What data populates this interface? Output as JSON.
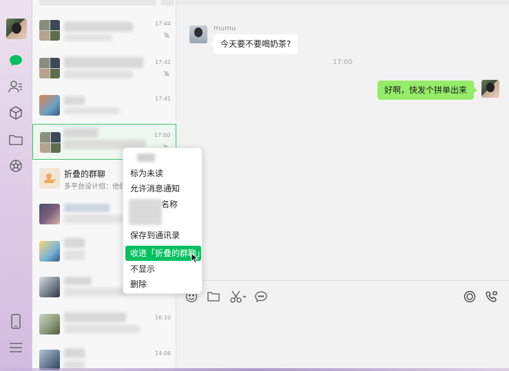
{
  "colors": {
    "accent_green": "#07c160",
    "bubble_green": "#95ec69",
    "selected_border": "#3cc16a",
    "rail_purple": "#dcc8e4"
  },
  "rail": {
    "icons": [
      "chat-icon",
      "contacts-icon",
      "box-icon",
      "folder-icon",
      "moments-icon",
      "phone-icon",
      "menu-icon"
    ]
  },
  "chatlist": {
    "rows": [
      {
        "time": "17:44",
        "muted": true
      },
      {
        "time": "17:42",
        "muted": true
      },
      {
        "time": "17:41",
        "muted": false
      },
      {
        "time": "17:00",
        "muted": true
      },
      {
        "title": "折叠的群聊",
        "preview": "多平台设计组：他们"
      },
      {
        "time": "",
        "muted": false
      },
      {
        "time": "",
        "muted": false
      },
      {
        "time": "",
        "muted": false
      },
      {
        "time": "16:10",
        "muted": false
      },
      {
        "time": "14:06",
        "muted": false
      }
    ]
  },
  "chat": {
    "sender_name": "mumu",
    "incoming_message": "今天要不要喝奶茶?",
    "center_time": "17:00",
    "outgoing_message": "好啊，快发个拼单出来"
  },
  "toolbar": {
    "icons": [
      "emoji-icon",
      "folder-icon",
      "scissors-icon",
      "chat-bubble-icon",
      "record-icon",
      "video-call-icon"
    ]
  },
  "context_menu": {
    "items": [
      {
        "label": "标为未读"
      },
      {
        "label": "允许消息通知"
      },
      {
        "label": "名称"
      },
      {
        "label": "保存到通讯录"
      },
      {
        "label": "收进「折叠的群聊」",
        "active": true
      },
      {
        "label": "不显示"
      },
      {
        "label": "删除"
      }
    ]
  }
}
